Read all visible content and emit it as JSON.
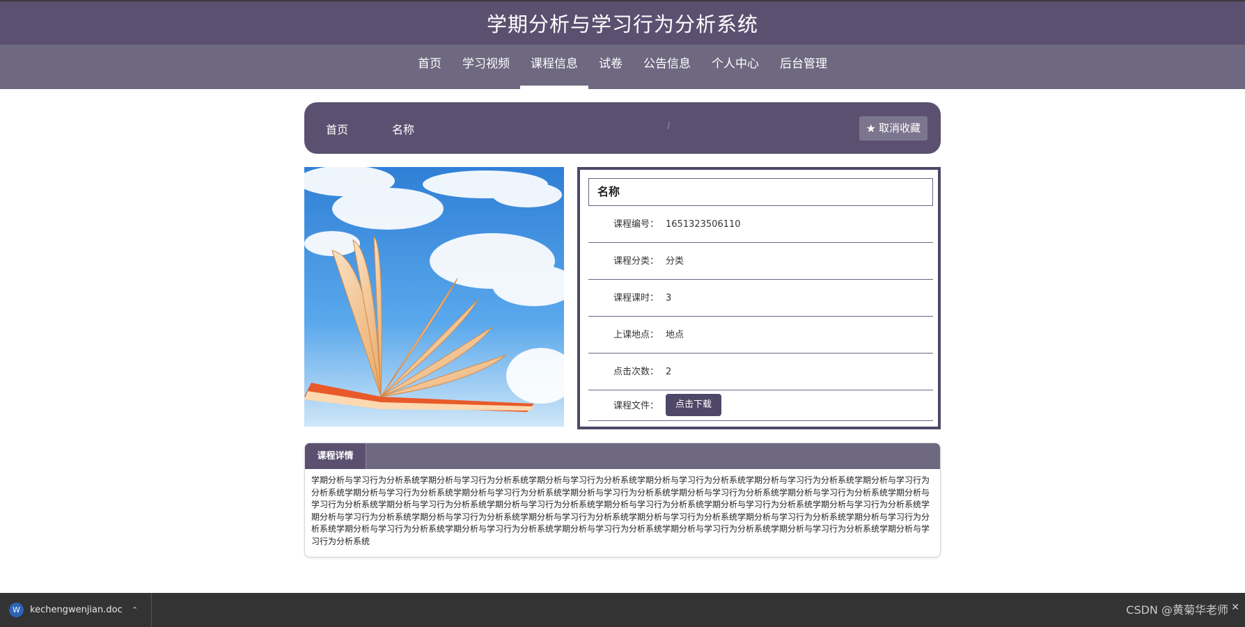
{
  "header": {
    "title": "学期分析与学习行为分析系统"
  },
  "nav": {
    "items": [
      {
        "label": "首页",
        "active": false
      },
      {
        "label": "学习视频",
        "active": false
      },
      {
        "label": "课程信息",
        "active": true
      },
      {
        "label": "试卷",
        "active": false
      },
      {
        "label": "公告信息",
        "active": false
      },
      {
        "label": "个人中心",
        "active": false
      },
      {
        "label": "后台管理",
        "active": false
      }
    ]
  },
  "breadcrumb": {
    "home": "首页",
    "separator": "/",
    "current": "名称",
    "favorite_button": "取消收藏"
  },
  "course": {
    "name": "名称",
    "fields": [
      {
        "label": "课程编号：",
        "value": "1651323506110"
      },
      {
        "label": "课程分类：",
        "value": "分类"
      },
      {
        "label": "课程课时：",
        "value": "3"
      },
      {
        "label": "上课地点：",
        "value": "地点"
      },
      {
        "label": "点击次数：",
        "value": "2"
      }
    ],
    "file_label": "课程文件：",
    "download_button": "点击下载"
  },
  "detail": {
    "tab_label": "课程详情",
    "text": "学期分析与学习行为分析系统学期分析与学习行为分析系统学期分析与学习行为分析系统学期分析与学习行为分析系统学期分析与学习行为分析系统学期分析与学习行为分析系统学期分析与学习行为分析系统学期分析与学习行为分析系统学期分析与学习行为分析系统学期分析与学习行为分析系统学期分析与学习行为分析系统学期分析与学习行为分析系统学期分析与学习行为分析系统学期分析与学习行为分析系统学期分析与学习行为分析系统学期分析与学习行为分析系统学期分析与学习行为分析系统学期分析与学习行为分析系统学期分析与学习行为分析系统学期分析与学习行为分析系统学期分析与学习行为分析系统学期分析与学习行为分析系统学期分析与学习行为分析系统学期分析与学习行为分析系统学期分析与学习行为分析系统学期分析与学习行为分析系统学期分析与学习行为分析系统学期分析与学习行为分析系统学期分析与学习行为分析系统"
  },
  "taskbar": {
    "download_file": "kechengwenjian.doc",
    "watermark": "CSDN @黄菊华老师"
  },
  "colors": {
    "header": "#5b5070",
    "nav": "#6e6880",
    "accent": "#4f4768"
  }
}
